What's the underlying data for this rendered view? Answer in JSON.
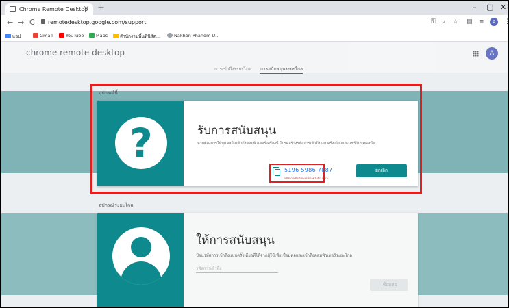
{
  "browser": {
    "tab_title": "Chrome Remote Desktop",
    "tab_close": "×",
    "new_tab": "+",
    "win_min": "–",
    "win_max": "▢",
    "win_close": "✕",
    "url": "remotedesktop.google.com/support",
    "nav_back": "←",
    "nav_forward": "→",
    "nav_reload": "C",
    "avatar_letter": "A"
  },
  "bookmarks": [
    {
      "label": "แอป",
      "color": "#4285f4"
    },
    {
      "label": "Gmail",
      "color": "#ea4335"
    },
    {
      "label": "YouTube",
      "color": "#ff0000"
    },
    {
      "label": "Maps",
      "color": "#34a853"
    },
    {
      "label": "สำนักงานพื้นที่นิสิต...",
      "color": "#fbbc04"
    },
    {
      "label": "Nakhon Phanom U...",
      "color": "#9aa0a6"
    }
  ],
  "app": {
    "title": "chrome remote desktop",
    "avatar_letter": "A",
    "tabs": {
      "remote_access": "การเข้าถึงระยะไกล",
      "remote_support": "การสนับสนุนระยะไกล"
    }
  },
  "get_support": {
    "section_label": "อุปกรณ์นี้",
    "title": "รับการสนับสนุน",
    "description": "หากต้องการให้บุคคลอื่นเข้าถึงคอมพิวเตอร์เครื่องนี้ โปรดสร้างรหัสการเข้าถึงแบบครั้งเดียวและแชร์กับบุคคลนั้น",
    "access_code": "5196 5986 7887",
    "code_hint": "รหัสการเข้าถึงจะหมดอายุในอีก 4:55",
    "cancel_label": "ยกเลิก"
  },
  "give_support": {
    "section_label": "อุปกรณ์ระยะไกล",
    "title": "ให้การสนับสนุน",
    "description": "ป้อนรหัสการเข้าถึงแบบครั้งเดียวที่ได้จากผู้ใช้เพื่อเชื่อมต่อและเข้าถึงคอมพิวเตอร์ระยะไกล",
    "input_placeholder": "รหัสการเข้าถึง",
    "connect_label": "เชื่อมต่อ"
  },
  "colors": {
    "brand_teal": "#0e8a8f",
    "highlight_red": "#e02020"
  }
}
